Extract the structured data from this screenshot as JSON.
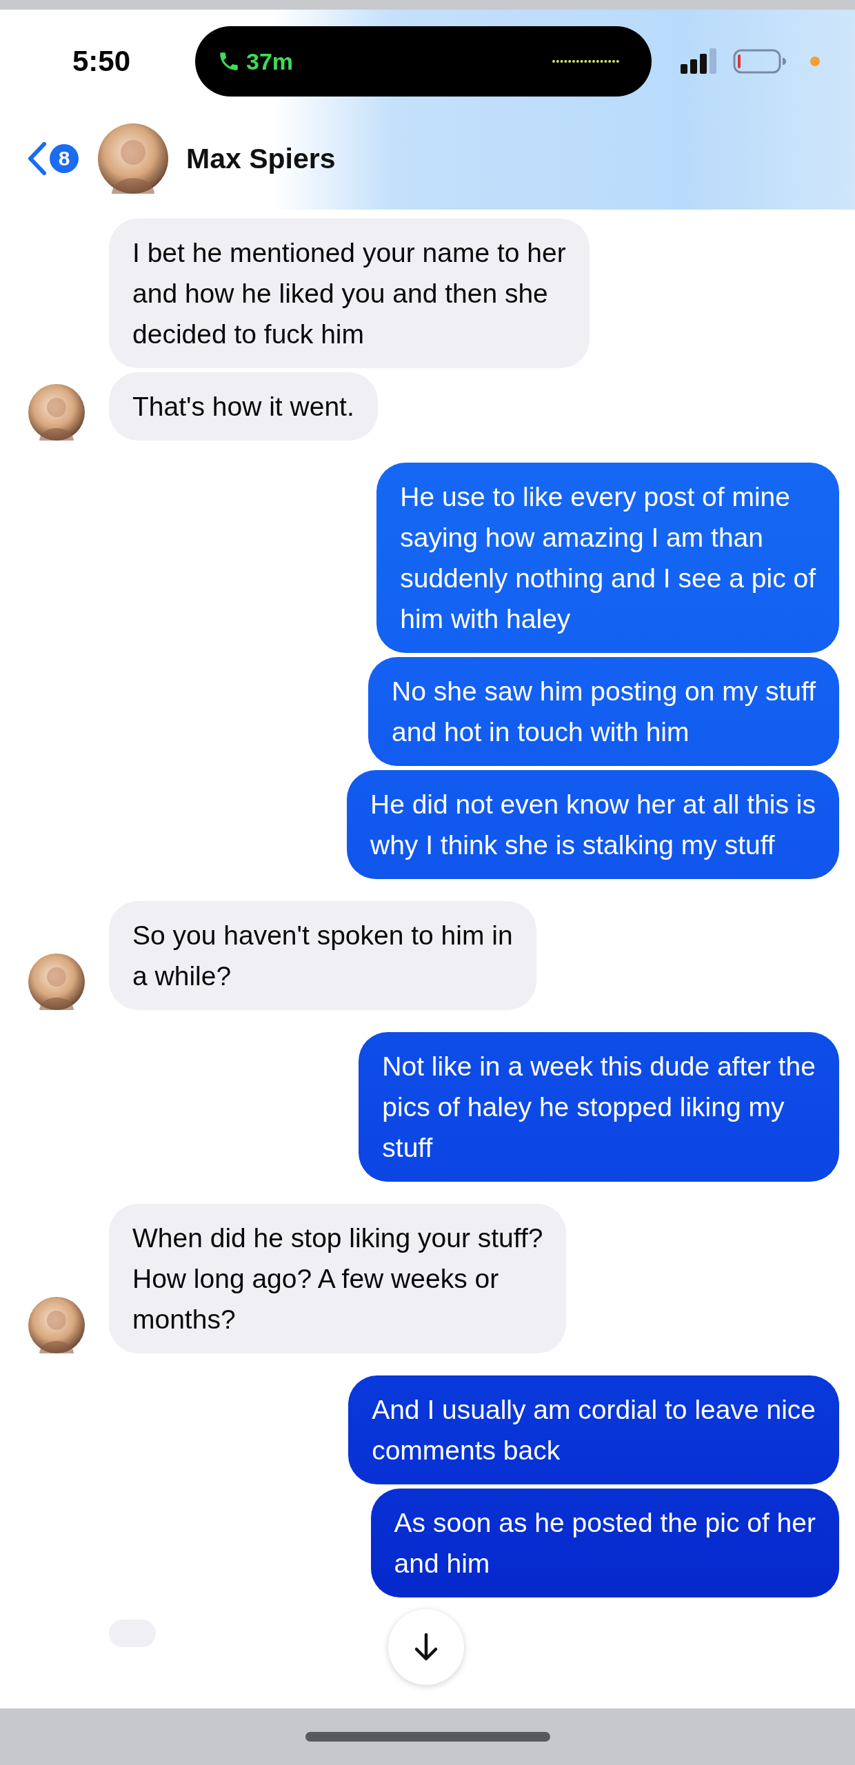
{
  "status_bar": {
    "time": "5:50",
    "call_duration": "37m"
  },
  "header": {
    "unread_count": "8",
    "contact_name": "Max Spiers"
  },
  "messages": [
    {
      "kind": "received",
      "avatar": false,
      "text": "I bet he mentioned your name to her\nand how he liked you and then she\ndecided to fuck him"
    },
    {
      "kind": "received",
      "avatar": true,
      "text": "That's how it went."
    },
    {
      "kind": "sent",
      "text": "He use to like every post of mine\nsaying how amazing I am than\nsuddenly nothing and I see a pic of\nhim with haley"
    },
    {
      "kind": "sent",
      "text": "No she saw him posting on my stuff\nand hot in touch with him"
    },
    {
      "kind": "sent",
      "text": "He did not even know her at all this is\nwhy I think she is stalking my stuff"
    },
    {
      "kind": "received",
      "avatar": true,
      "text": "So you haven't spoken to him in\na while?"
    },
    {
      "kind": "sent",
      "text": "Not like in a week this dude after the\npics of haley he stopped liking my\nstuff"
    },
    {
      "kind": "received",
      "avatar": true,
      "text": "When did he stop liking your stuff?\nHow long ago? A few weeks or\nmonths?"
    },
    {
      "kind": "sent",
      "text": "And I usually am cordial to leave nice\ncomments back"
    },
    {
      "kind": "sent",
      "text": "As soon as he posted the pic of her\nand him"
    },
    {
      "kind": "received",
      "avatar": false
    }
  ]
}
